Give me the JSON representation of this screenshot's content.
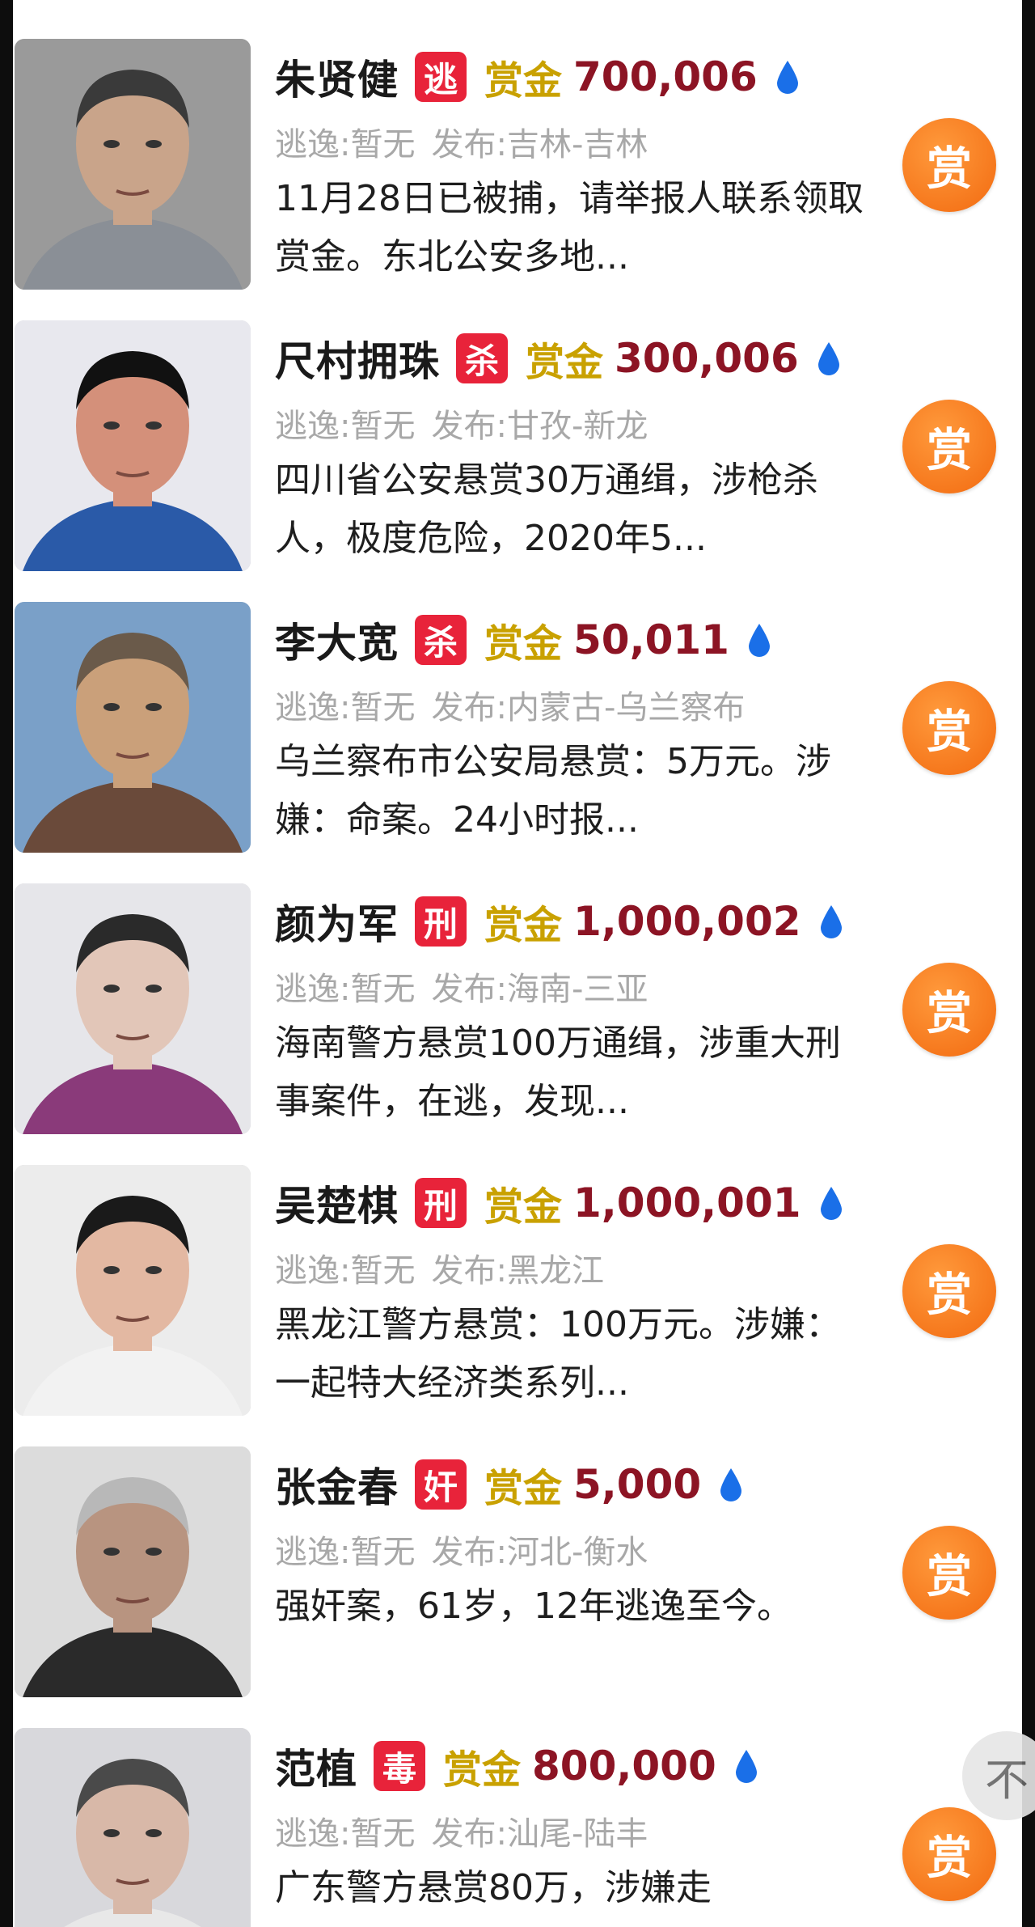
{
  "bounty_label": "赏金",
  "reward_button_label": "赏",
  "float_button_label": "不",
  "colors": {
    "badge_red": "#e8233a",
    "bounty_gold": "#c9a100",
    "bounty_value": "#8c1424",
    "drop_blue": "#1a6fe8",
    "reward_orange": "#f26a10"
  },
  "entries": [
    {
      "name": "朱贤健",
      "badge": "逃",
      "amount": "700,006",
      "escape": "逃逸:暂无",
      "publish": "发布:吉林-吉林",
      "description": "11月28日已被捕，请举报人联系领取赏金。东北公安多地..."
    },
    {
      "name": "尺村拥珠",
      "badge": "杀",
      "amount": "300,006",
      "escape": "逃逸:暂无",
      "publish": "发布:甘孜-新龙",
      "description": "四川省公安悬赏30万通缉，涉枪杀人，极度危险，2020年5..."
    },
    {
      "name": "李大宽",
      "badge": "杀",
      "amount": "50,011",
      "escape": "逃逸:暂无",
      "publish": "发布:内蒙古-乌兰察布",
      "description": "乌兰察布市公安局悬赏：5万元。涉嫌：命案。24小时报..."
    },
    {
      "name": "颜为军",
      "badge": "刑",
      "amount": "1,000,002",
      "escape": "逃逸:暂无",
      "publish": "发布:海南-三亚",
      "description": "海南警方悬赏100万通缉，涉重大刑事案件，在逃，发现..."
    },
    {
      "name": "吴楚棋",
      "badge": "刑",
      "amount": "1,000,001",
      "escape": "逃逸:暂无",
      "publish": "发布:黑龙江",
      "description": "黑龙江警方悬赏：100万元。涉嫌：一起特大经济类系列..."
    },
    {
      "name": "张金春",
      "badge": "奸",
      "amount": "5,000",
      "escape": "逃逸:暂无",
      "publish": "发布:河北-衡水",
      "description": "强奸案，61岁，12年逃逸至今。"
    },
    {
      "name": "范植",
      "badge": "毒",
      "amount": "800,000",
      "escape": "逃逸:暂无",
      "publish": "发布:汕尾-陆丰",
      "description": "广东警方悬赏80万，涉嫌走"
    }
  ]
}
